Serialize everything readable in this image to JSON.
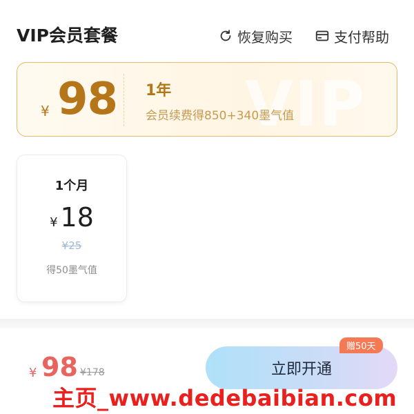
{
  "header": {
    "title": "VIP会员套餐",
    "restore_label": "恢复购买",
    "help_label": "支付帮助"
  },
  "plans": [
    {
      "name": "1年",
      "currency": "¥",
      "price": "98",
      "description": "会员续费得850+340墨气值",
      "watermark_text": "VIP",
      "selected": true
    },
    {
      "name": "1个月",
      "currency": "¥",
      "price": "18",
      "original_price": "¥25",
      "description": "得50墨气值",
      "selected": false
    }
  ],
  "checkout": {
    "currency": "¥",
    "price": "98",
    "original_price": "¥178",
    "button_label": "立即开通",
    "badge": "赠50天"
  },
  "overlay": {
    "watermark": "主页_www.dedebaibian.com"
  },
  "colors": {
    "gold": "#b5761a",
    "gold_border": "#e3b96a",
    "price_red": "#e8655f",
    "badge_orange": "#f47a56",
    "watermark_red": "#e8211e"
  },
  "icons": [
    "refresh-icon",
    "card-icon"
  ]
}
